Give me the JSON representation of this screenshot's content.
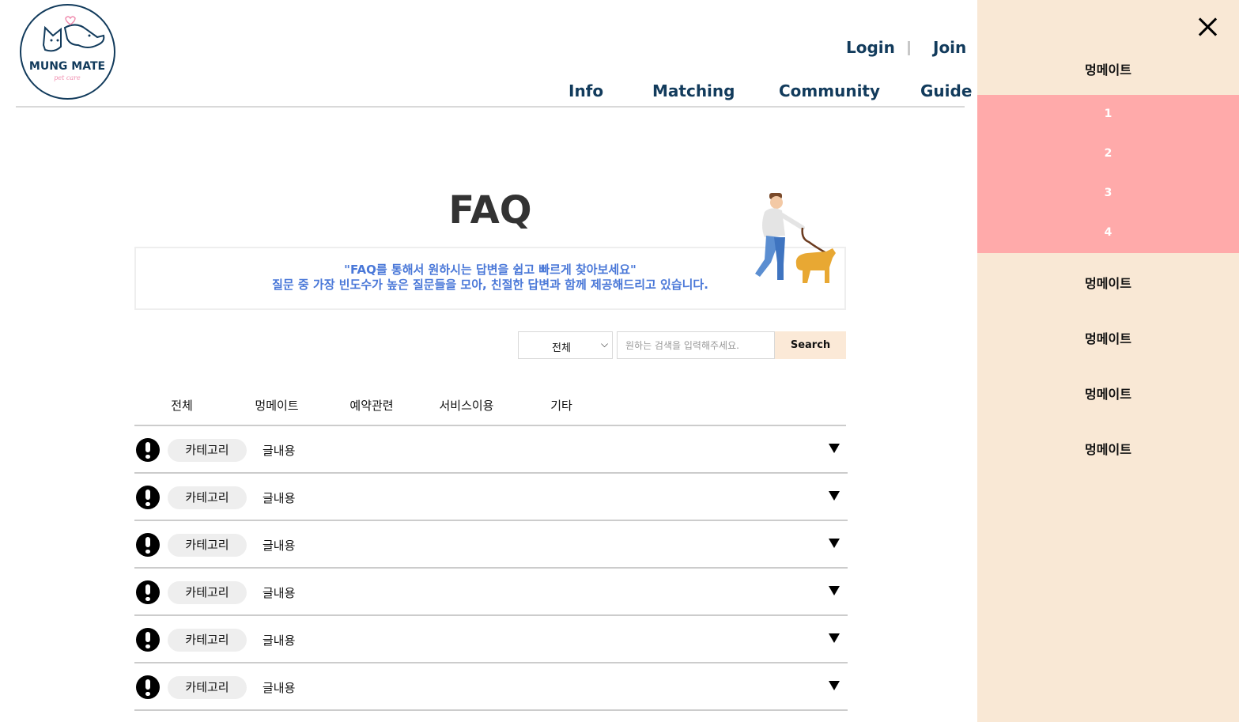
{
  "header": {
    "logo_text": "MUNG MATE",
    "logo_sub": "pet care",
    "login_label": "Login",
    "join_label": "Join",
    "nav": [
      "Info",
      "Matching",
      "Community",
      "Guide"
    ]
  },
  "main": {
    "title": "FAQ",
    "intro_line1": "\"FAQ를 통해서 원하시는 답변을 쉽고 빠르게 찾아보세요\"",
    "intro_line2": "질문 중 가장 빈도수가 높은 질문들을 모아, 친절한 답변과 함께 제공해드리고 있습니다.",
    "search": {
      "select_value": "전체",
      "placeholder": "원하는 검색을 입력해주세요.",
      "button_label": "Search"
    },
    "tabs": [
      "전체",
      "멍메이트",
      "예약관련",
      "서비스이용",
      "기타"
    ],
    "faq_rows": [
      {
        "category": "카테고리",
        "text": "글내용"
      },
      {
        "category": "카테고리",
        "text": "글내용"
      },
      {
        "category": "카테고리",
        "text": "글내용"
      },
      {
        "category": "카테고리",
        "text": "글내용"
      },
      {
        "category": "카테고리",
        "text": "글내용"
      },
      {
        "category": "카테고리",
        "text": "글내용"
      }
    ]
  },
  "side_menu": {
    "items": [
      "멍메이트",
      "멍메이트",
      "멍메이트",
      "멍메이트",
      "멍메이트"
    ],
    "sub_items": [
      "1",
      "2",
      "3",
      "4"
    ]
  },
  "colors": {
    "navy": "#123b5c",
    "intro_blue": "#4a78d8",
    "side_bg": "#f9e8d5",
    "sub_bg": "#ffaaaa",
    "search_btn": "#fbe9d7"
  }
}
